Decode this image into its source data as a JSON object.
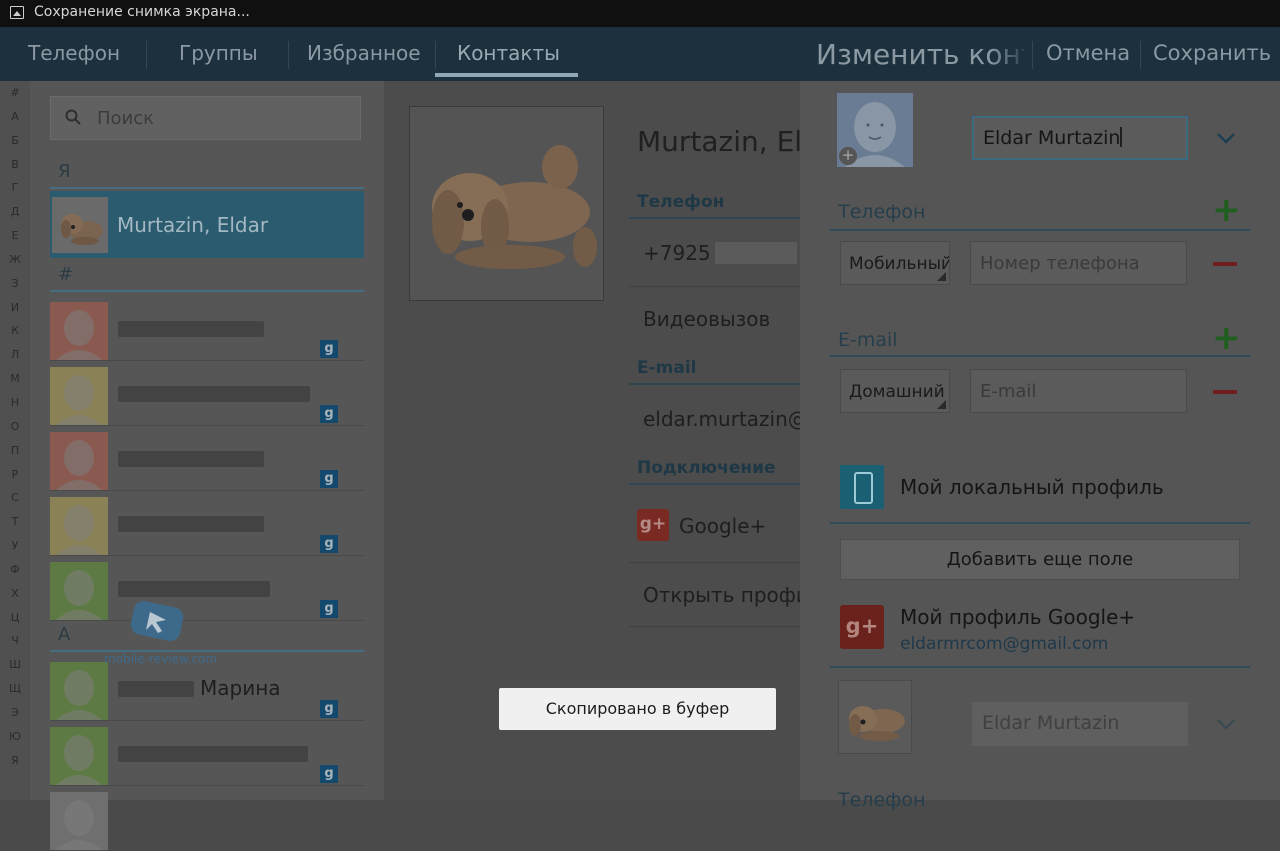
{
  "status_bar": {
    "text": "Сохранение снимка экрана..."
  },
  "action_bar": {
    "tabs": [
      {
        "label": "Телефон"
      },
      {
        "label": "Группы"
      },
      {
        "label": "Избранное"
      },
      {
        "label": "Контакты"
      }
    ],
    "active_tab": "Контакты",
    "edit_title": "Изменить конт",
    "cancel_label": "Отмена",
    "save_label": "Сохранить"
  },
  "alphabet": [
    "#",
    "А",
    "Б",
    "В",
    "Г",
    "Д",
    "Е",
    "Ж",
    "З",
    "И",
    "К",
    "Л",
    "М",
    "Н",
    "О",
    "П",
    "Р",
    "С",
    "Т",
    "У",
    "Ф",
    "Х",
    "Ц",
    "Ч",
    "Ш",
    "Щ",
    "Э",
    "Ю",
    "Я"
  ],
  "contacts": {
    "search_placeholder": "Поиск",
    "section_me": "Я",
    "selected_contact": "Murtazin, Eldar",
    "section_hash": "#",
    "section_a": "А",
    "visible_name_fragment": "Марина",
    "google_badge": "g"
  },
  "detail": {
    "name": "Murtazin, Eld",
    "phone_section": "Телефон",
    "phone_value": "+7925",
    "video_call": "Видеовызов",
    "email_section": "E-mail",
    "email_value": "eldar.murtazin@",
    "connection_section": "Подключение",
    "googleplus_label": "Google+",
    "googleplus_icon": "g+",
    "open_profile": "Открыть профи"
  },
  "edit": {
    "name_value": "Eldar Murtazin",
    "phone_section": "Телефон",
    "phone_type": "Мобильный",
    "phone_placeholder": "Номер телефона",
    "email_section": "E-mail",
    "email_type": "Домашний",
    "email_placeholder": "E-mail",
    "local_profile": "Мой локальный профиль",
    "add_field": "Добавить еще поле",
    "googleplus_profile": "Мой профиль Google+",
    "googleplus_icon": "g+",
    "googleplus_email": "eldarmrcom@gmail.com",
    "second_name_value": "Eldar Murtazin",
    "bottom_section": "Телефон"
  },
  "toast": {
    "text": "Скопировано в буфер"
  },
  "watermark": {
    "text": "mobile-review.com"
  },
  "colors": {
    "actionbar": "#1c303d",
    "selected": "#2b5b6e",
    "add": "#1f5e1f",
    "remove": "#6e1e1e"
  }
}
